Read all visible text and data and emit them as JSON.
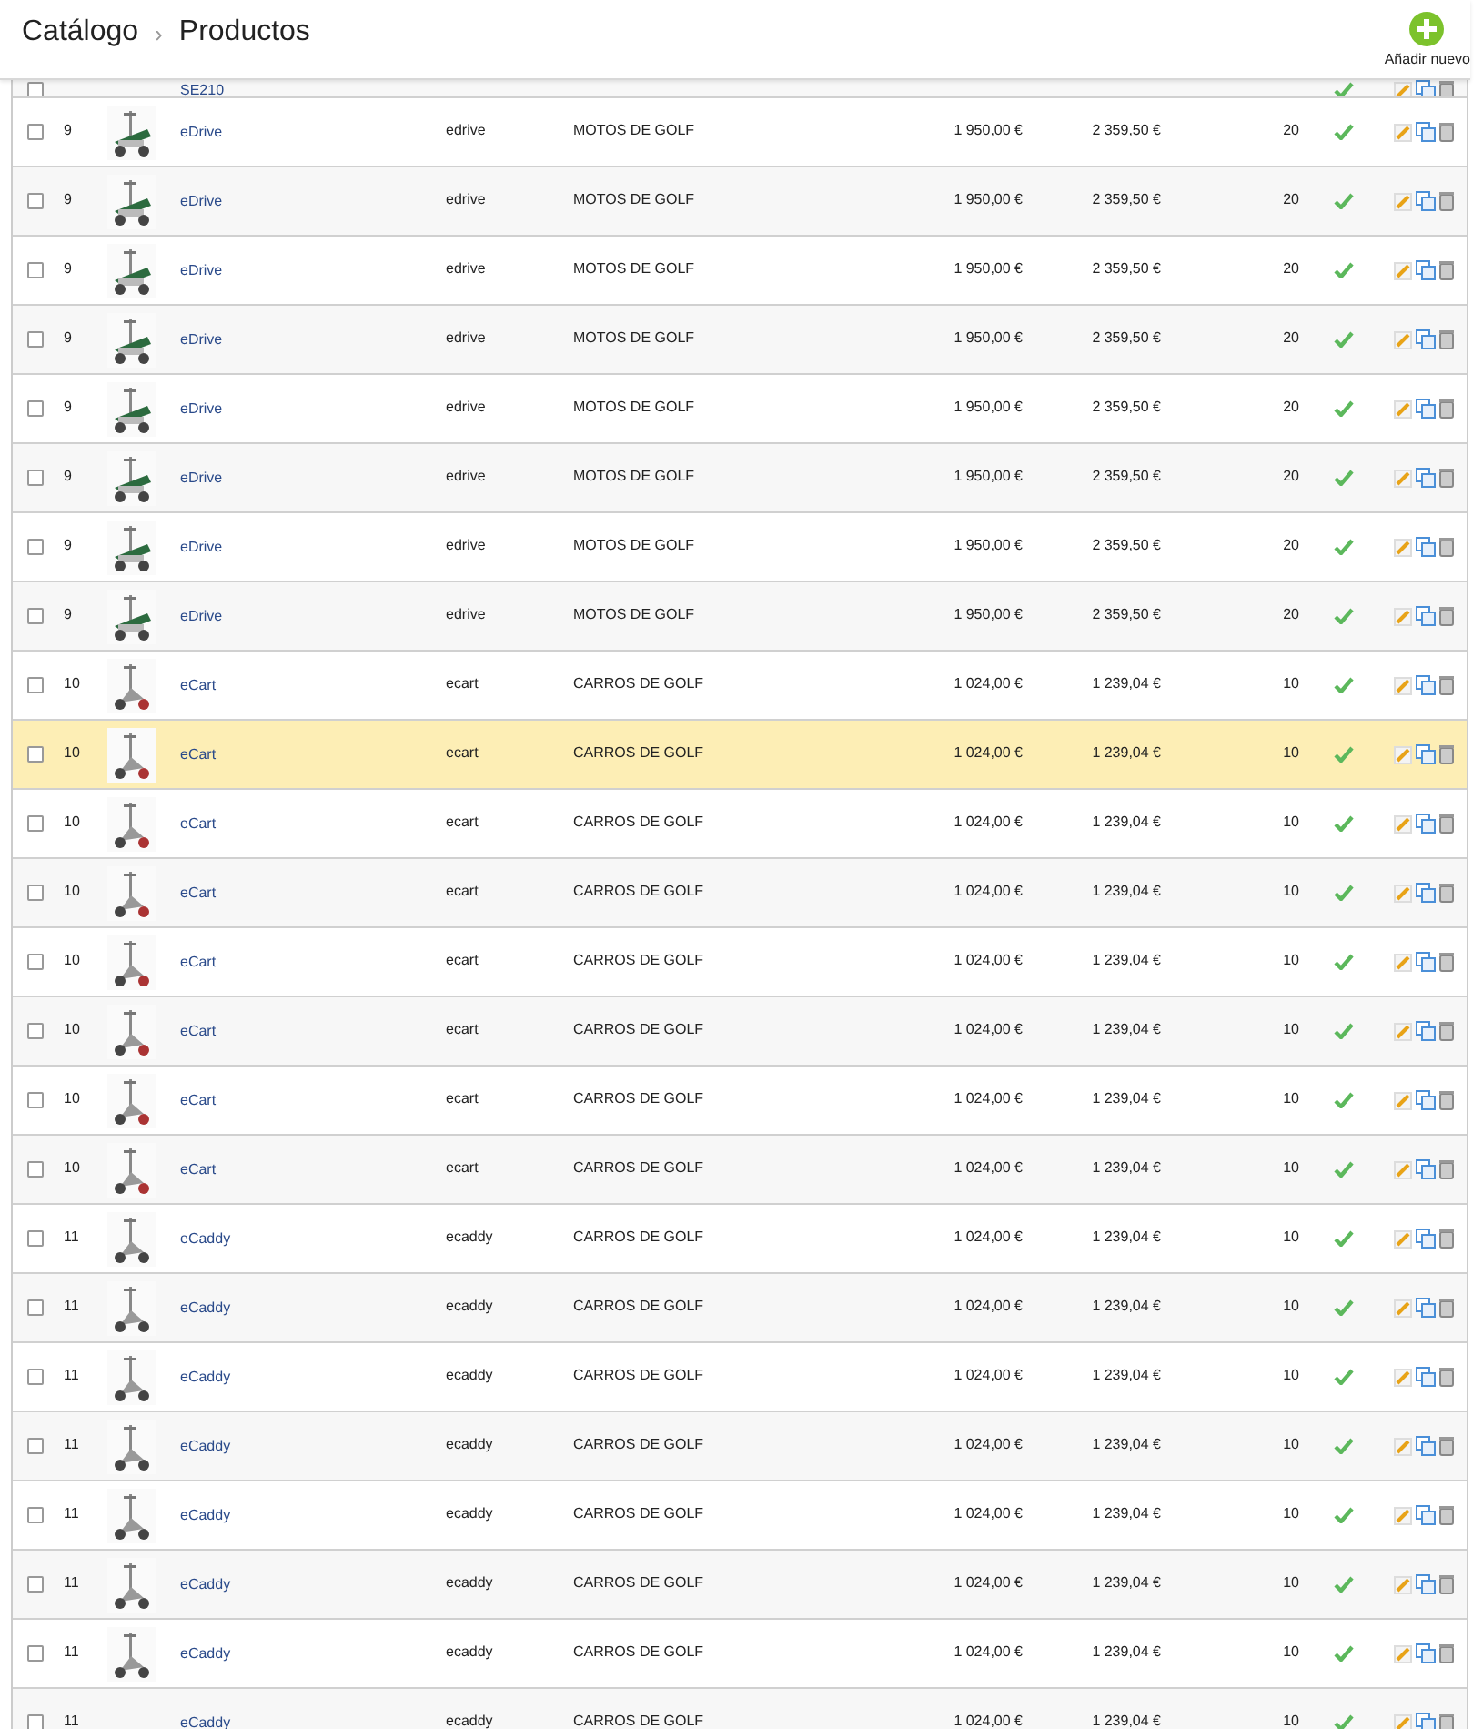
{
  "header": {
    "breadcrumb": [
      "Catálogo",
      "Productos"
    ],
    "separator": "›",
    "add_button": "Añadir nuevo"
  },
  "rows": [
    {
      "kind": "partial",
      "name": "SE210",
      "active": true,
      "selected": false
    },
    {
      "id": "9",
      "name": "eDrive",
      "reference": "edrive",
      "category": "MOTOS DE GOLF",
      "price": "1 950,00 €",
      "price_tax": "2 359,50 €",
      "quantity": "20",
      "active": true,
      "selected": false,
      "thumbnail": true
    },
    {
      "id": "9",
      "name": "eDrive",
      "reference": "edrive",
      "category": "MOTOS DE GOLF",
      "price": "1 950,00 €",
      "price_tax": "2 359,50 €",
      "quantity": "20",
      "active": true,
      "selected": false,
      "thumbnail": true
    },
    {
      "id": "9",
      "name": "eDrive",
      "reference": "edrive",
      "category": "MOTOS DE GOLF",
      "price": "1 950,00 €",
      "price_tax": "2 359,50 €",
      "quantity": "20",
      "active": true,
      "selected": false,
      "thumbnail": true
    },
    {
      "id": "9",
      "name": "eDrive",
      "reference": "edrive",
      "category": "MOTOS DE GOLF",
      "price": "1 950,00 €",
      "price_tax": "2 359,50 €",
      "quantity": "20",
      "active": true,
      "selected": false,
      "thumbnail": true
    },
    {
      "id": "9",
      "name": "eDrive",
      "reference": "edrive",
      "category": "MOTOS DE GOLF",
      "price": "1 950,00 €",
      "price_tax": "2 359,50 €",
      "quantity": "20",
      "active": true,
      "selected": false,
      "thumbnail": true
    },
    {
      "id": "9",
      "name": "eDrive",
      "reference": "edrive",
      "category": "MOTOS DE GOLF",
      "price": "1 950,00 €",
      "price_tax": "2 359,50 €",
      "quantity": "20",
      "active": true,
      "selected": false,
      "thumbnail": true
    },
    {
      "id": "9",
      "name": "eDrive",
      "reference": "edrive",
      "category": "MOTOS DE GOLF",
      "price": "1 950,00 €",
      "price_tax": "2 359,50 €",
      "quantity": "20",
      "active": true,
      "selected": false,
      "thumbnail": true
    },
    {
      "id": "9",
      "name": "eDrive",
      "reference": "edrive",
      "category": "MOTOS DE GOLF",
      "price": "1 950,00 €",
      "price_tax": "2 359,50 €",
      "quantity": "20",
      "active": true,
      "selected": false,
      "thumbnail": true
    },
    {
      "id": "10",
      "name": "eCart",
      "reference": "ecart",
      "category": "CARROS DE GOLF",
      "price": "1 024,00 €",
      "price_tax": "1 239,04 €",
      "quantity": "10",
      "active": true,
      "selected": false,
      "thumbnail": true
    },
    {
      "id": "10",
      "name": "eCart",
      "reference": "ecart",
      "category": "CARROS DE GOLF",
      "price": "1 024,00 €",
      "price_tax": "1 239,04 €",
      "quantity": "10",
      "active": true,
      "selected": true,
      "thumbnail": true
    },
    {
      "id": "10",
      "name": "eCart",
      "reference": "ecart",
      "category": "CARROS DE GOLF",
      "price": "1 024,00 €",
      "price_tax": "1 239,04 €",
      "quantity": "10",
      "active": true,
      "selected": false,
      "thumbnail": true
    },
    {
      "id": "10",
      "name": "eCart",
      "reference": "ecart",
      "category": "CARROS DE GOLF",
      "price": "1 024,00 €",
      "price_tax": "1 239,04 €",
      "quantity": "10",
      "active": true,
      "selected": false,
      "thumbnail": true
    },
    {
      "id": "10",
      "name": "eCart",
      "reference": "ecart",
      "category": "CARROS DE GOLF",
      "price": "1 024,00 €",
      "price_tax": "1 239,04 €",
      "quantity": "10",
      "active": true,
      "selected": false,
      "thumbnail": true
    },
    {
      "id": "10",
      "name": "eCart",
      "reference": "ecart",
      "category": "CARROS DE GOLF",
      "price": "1 024,00 €",
      "price_tax": "1 239,04 €",
      "quantity": "10",
      "active": true,
      "selected": false,
      "thumbnail": true
    },
    {
      "id": "10",
      "name": "eCart",
      "reference": "ecart",
      "category": "CARROS DE GOLF",
      "price": "1 024,00 €",
      "price_tax": "1 239,04 €",
      "quantity": "10",
      "active": true,
      "selected": false,
      "thumbnail": true
    },
    {
      "id": "10",
      "name": "eCart",
      "reference": "ecart",
      "category": "CARROS DE GOLF",
      "price": "1 024,00 €",
      "price_tax": "1 239,04 €",
      "quantity": "10",
      "active": true,
      "selected": false,
      "thumbnail": true
    },
    {
      "id": "11",
      "name": "eCaddy",
      "reference": "ecaddy",
      "category": "CARROS DE GOLF",
      "price": "1 024,00 €",
      "price_tax": "1 239,04 €",
      "quantity": "10",
      "active": true,
      "selected": false,
      "thumbnail": true
    },
    {
      "id": "11",
      "name": "eCaddy",
      "reference": "ecaddy",
      "category": "CARROS DE GOLF",
      "price": "1 024,00 €",
      "price_tax": "1 239,04 €",
      "quantity": "10",
      "active": true,
      "selected": false,
      "thumbnail": true
    },
    {
      "id": "11",
      "name": "eCaddy",
      "reference": "ecaddy",
      "category": "CARROS DE GOLF",
      "price": "1 024,00 €",
      "price_tax": "1 239,04 €",
      "quantity": "10",
      "active": true,
      "selected": false,
      "thumbnail": true
    },
    {
      "id": "11",
      "name": "eCaddy",
      "reference": "ecaddy",
      "category": "CARROS DE GOLF",
      "price": "1 024,00 €",
      "price_tax": "1 239,04 €",
      "quantity": "10",
      "active": true,
      "selected": false,
      "thumbnail": true
    },
    {
      "id": "11",
      "name": "eCaddy",
      "reference": "ecaddy",
      "category": "CARROS DE GOLF",
      "price": "1 024,00 €",
      "price_tax": "1 239,04 €",
      "quantity": "10",
      "active": true,
      "selected": false,
      "thumbnail": true
    },
    {
      "id": "11",
      "name": "eCaddy",
      "reference": "ecaddy",
      "category": "CARROS DE GOLF",
      "price": "1 024,00 €",
      "price_tax": "1 239,04 €",
      "quantity": "10",
      "active": true,
      "selected": false,
      "thumbnail": true
    },
    {
      "id": "11",
      "name": "eCaddy",
      "reference": "ecaddy",
      "category": "CARROS DE GOLF",
      "price": "1 024,00 €",
      "price_tax": "1 239,04 €",
      "quantity": "10",
      "active": true,
      "selected": false,
      "thumbnail": true
    },
    {
      "id": "11",
      "name": "eCaddy",
      "reference": "ecaddy",
      "category": "CARROS DE GOLF",
      "price": "1 024,00 €",
      "price_tax": "1 239,04 €",
      "quantity": "10",
      "active": true,
      "selected": false,
      "thumbnail": false
    }
  ]
}
